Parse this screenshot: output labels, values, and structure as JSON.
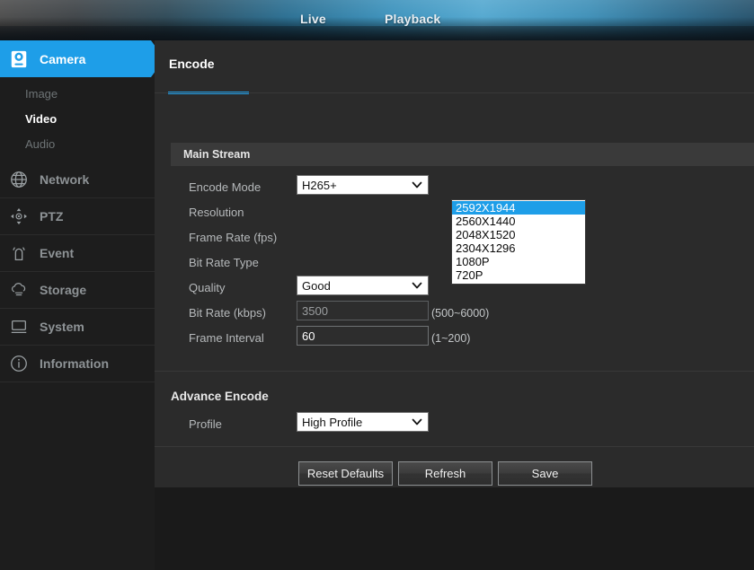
{
  "header": {
    "nav": [
      {
        "label": "Live",
        "name": "nav-live"
      },
      {
        "label": "Playback",
        "name": "nav-playback"
      }
    ]
  },
  "sidebar": {
    "items": [
      {
        "label": "Camera",
        "icon": "camera-icon",
        "active": true,
        "children": [
          {
            "label": "Image",
            "current": false
          },
          {
            "label": "Video",
            "current": true
          },
          {
            "label": "Audio",
            "current": false
          }
        ]
      },
      {
        "label": "Network",
        "icon": "network-globe-icon",
        "active": false
      },
      {
        "label": "PTZ",
        "icon": "ptz-dpad-icon",
        "active": false
      },
      {
        "label": "Event",
        "icon": "event-bell-icon",
        "active": false
      },
      {
        "label": "Storage",
        "icon": "storage-cloud-icon",
        "active": false
      },
      {
        "label": "System",
        "icon": "system-monitor-icon",
        "active": false
      },
      {
        "label": "Information",
        "icon": "info-circle-icon",
        "active": false
      }
    ]
  },
  "main": {
    "tab": {
      "label": "Encode"
    },
    "main_stream": {
      "title": "Main Stream",
      "fields": {
        "encode_mode": {
          "label": "Encode Mode",
          "value": "H265+"
        },
        "resolution": {
          "label": "Resolution",
          "value": "2592X1944",
          "options": [
            "2592X1944",
            "2560X1440",
            "2048X1520",
            "2304X1296",
            "1080P",
            "720P"
          ],
          "open": true
        },
        "frame_rate": {
          "label": "Frame Rate (fps)",
          "value": ""
        },
        "bit_rate_type": {
          "label": "Bit Rate Type",
          "value": ""
        },
        "quality": {
          "label": "Quality",
          "value": "Good"
        },
        "bit_rate": {
          "label": "Bit Rate (kbps)",
          "value": "3500",
          "hint": "(500~6000)"
        },
        "frame_interval": {
          "label": "Frame Interval",
          "value": "60",
          "hint": "(1~200)"
        }
      }
    },
    "advance_encode": {
      "title": "Advance Encode",
      "profile": {
        "label": "Profile",
        "value": "High Profile"
      }
    },
    "buttons": {
      "reset": "Reset Defaults",
      "refresh": "Refresh",
      "save": "Save"
    }
  },
  "colors": {
    "accent": "#1e9ee8",
    "panel": "#2b2b2b",
    "sidebar": "#1d1d1d",
    "section_header": "#3a3a3a"
  }
}
